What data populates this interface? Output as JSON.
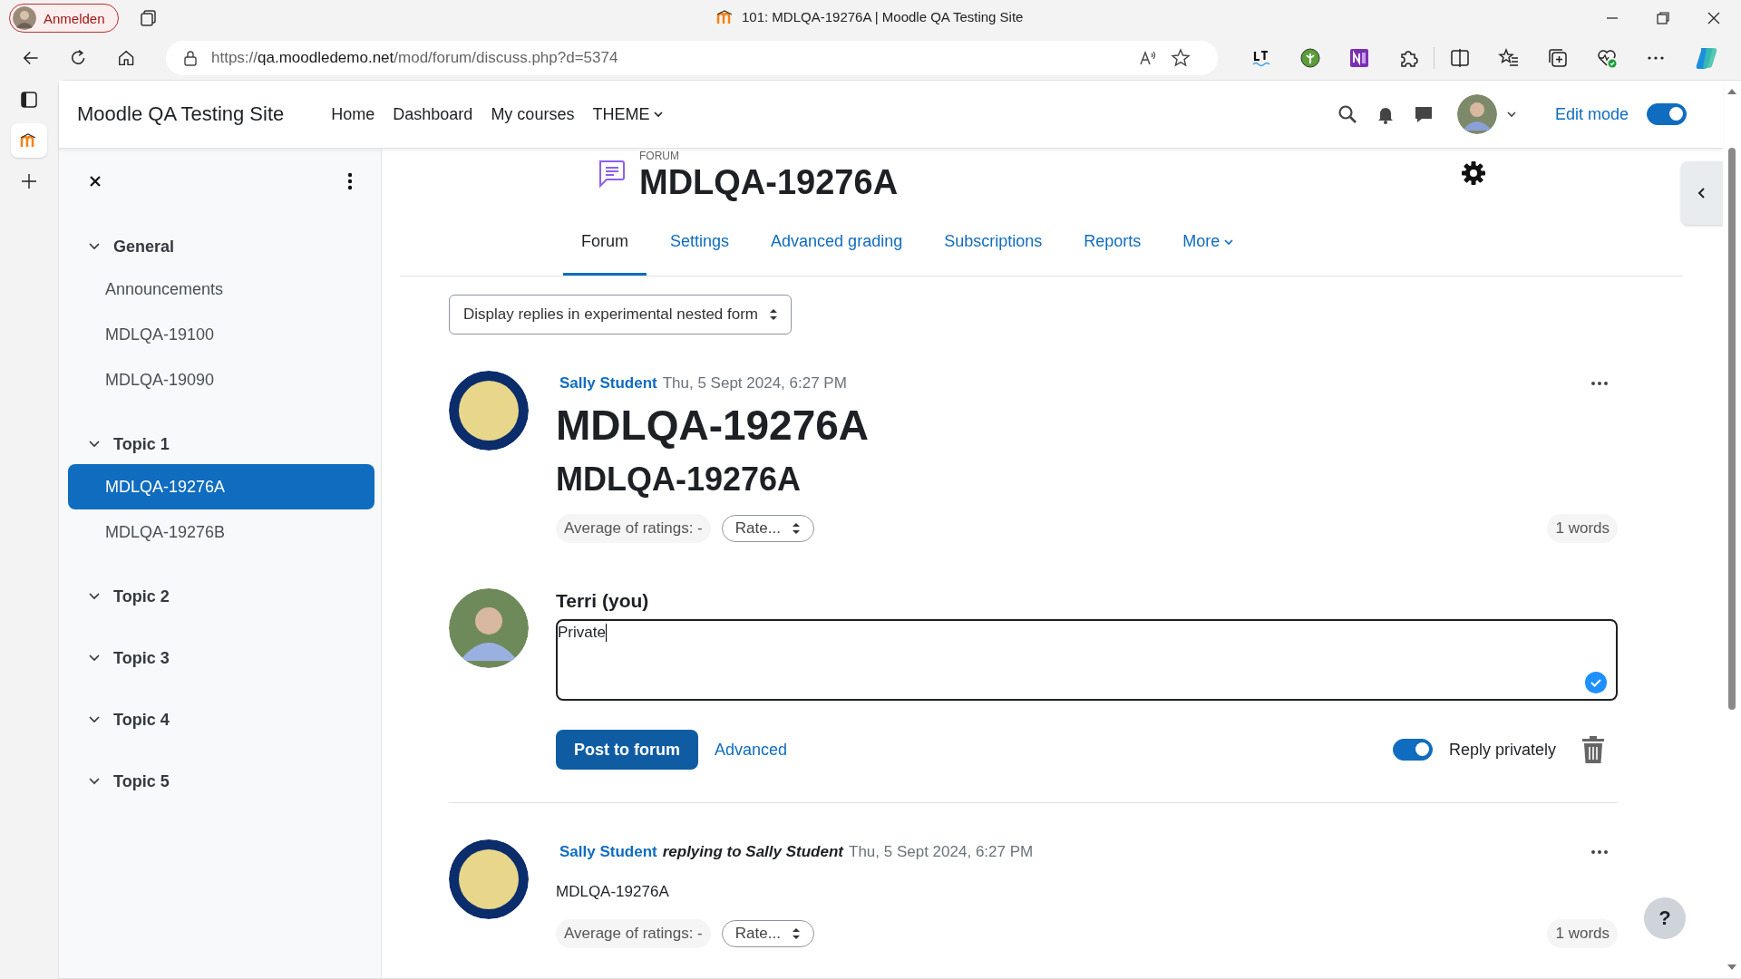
{
  "browser": {
    "profile_button": "Anmelden",
    "tab_title": "101: MDLQA-19276A | Moodle QA Testing Site",
    "url_scheme": "https://",
    "url_host": "qa.moodledemo.net",
    "url_path": "/mod/forum/discuss.php?d=5374"
  },
  "site": {
    "name": "Moodle QA Testing Site",
    "nav": [
      {
        "label": "Home",
        "has_menu": false
      },
      {
        "label": "Dashboard",
        "has_menu": false
      },
      {
        "label": "My courses",
        "has_menu": false
      },
      {
        "label": "THEME",
        "has_menu": true
      }
    ],
    "edit_mode": {
      "label": "Edit mode",
      "on": true
    }
  },
  "sidebar": {
    "sections": [
      {
        "title": "General",
        "expanded": true,
        "items": [
          {
            "label": "Announcements",
            "selected": false
          },
          {
            "label": "MDLQA-19100",
            "selected": false
          },
          {
            "label": "MDLQA-19090",
            "selected": false
          }
        ]
      },
      {
        "title": "Topic 1",
        "expanded": true,
        "items": [
          {
            "label": "MDLQA-19276A",
            "selected": true
          },
          {
            "label": "MDLQA-19276B",
            "selected": false
          }
        ]
      },
      {
        "title": "Topic 2",
        "expanded": true
      },
      {
        "title": "Topic 3",
        "expanded": true
      },
      {
        "title": "Topic 4",
        "expanded": true
      },
      {
        "title": "Topic 5",
        "expanded": true
      }
    ]
  },
  "page": {
    "kicker": "FORUM",
    "title": "MDLQA-19276A",
    "tabs": [
      {
        "label": "Forum",
        "selected": true,
        "has_menu": false
      },
      {
        "label": "Settings",
        "selected": false,
        "has_menu": false
      },
      {
        "label": "Advanced grading",
        "selected": false,
        "has_menu": false
      },
      {
        "label": "Subscriptions",
        "selected": false,
        "has_menu": false
      },
      {
        "label": "Reports",
        "selected": false,
        "has_menu": false
      },
      {
        "label": "More",
        "selected": false,
        "has_menu": true
      }
    ],
    "display_mode": "Display replies in experimental nested form"
  },
  "posts": [
    {
      "author": "Sally Student",
      "date": "Thu, 5 Sept 2024, 6:27 PM",
      "subject": "MDLQA-19276A",
      "body": {
        "kind": "heading",
        "text": "MDLQA-19276A"
      },
      "rating": "Average of ratings: -",
      "rate": "Rate...",
      "word_count": "1 words",
      "reply_form": {
        "author": "Terri (you)",
        "value": "Private",
        "submit": "Post to forum",
        "advanced": "Advanced",
        "private": {
          "label": "Reply privately",
          "on": true
        }
      }
    },
    {
      "author": "Sally Student",
      "relation": "replying to Sally Student",
      "date": "Thu, 5 Sept 2024, 6:27 PM",
      "body": {
        "kind": "text",
        "text": "MDLQA-19276A"
      },
      "rating": "Average of ratings: -",
      "rate": "Rate...",
      "word_count": "1 words"
    }
  ],
  "help_button": "?"
}
